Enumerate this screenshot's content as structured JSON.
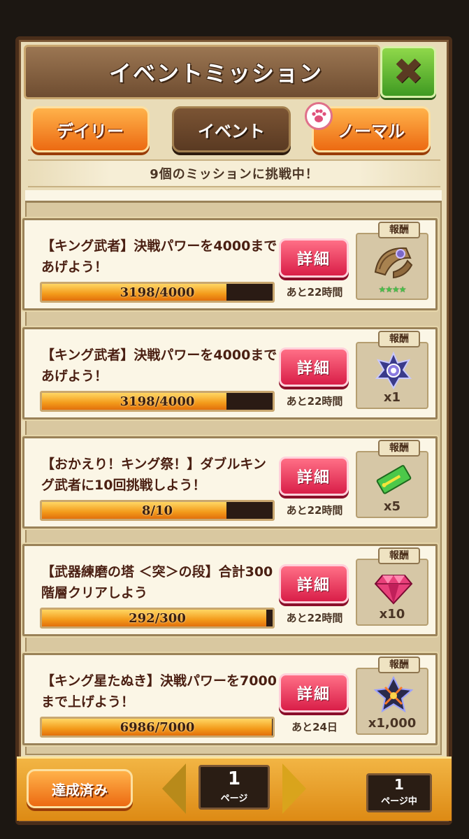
{
  "header": {
    "title": "イベントミッション",
    "close_icon": "✖"
  },
  "tabs": [
    {
      "label": "デイリー",
      "active": false
    },
    {
      "label": "イベント",
      "active": true
    },
    {
      "label": "ノーマル",
      "active": false,
      "badge_icon": "paw-icon"
    }
  ],
  "banner": "9個のミッションに挑戦中！",
  "reward_label": "報酬",
  "detail_label": "詳細",
  "missions": [
    {
      "text": "【キング武者】決戦パワーを4000まであげよう！",
      "progress_text": "3198/4000",
      "progress": 0.7995,
      "time_left": "あと22時間",
      "reward_icon": "fan-weapon-icon",
      "reward_qty": "",
      "reward_stars": "★★★★"
    },
    {
      "text": "【キング武者】決戦パワーを4000まであげよう！",
      "progress_text": "3198/4000",
      "progress": 0.7995,
      "time_left": "あと22時間",
      "reward_icon": "star-medal-icon",
      "reward_qty": "x1",
      "reward_stars": ""
    },
    {
      "text": "【おかえり！キング祭！】ダブルキング武者に10回挑戦しよう！",
      "progress_text": "8/10",
      "progress": 0.8,
      "time_left": "あと22時間",
      "reward_icon": "ticket-icon",
      "reward_qty": "x5",
      "reward_stars": ""
    },
    {
      "text": "【武器練磨の塔 ＜突＞の段】合計300階層クリアしよう",
      "progress_text": "292/300",
      "progress": 0.9733,
      "time_left": "あと22時間",
      "reward_icon": "gem-icon",
      "reward_qty": "x10",
      "reward_stars": ""
    },
    {
      "text": "【キング星たぬき】決戦パワーを7000まで上げよう！",
      "progress_text": "6986/7000",
      "progress": 0.998,
      "time_left": "あと24日",
      "reward_icon": "star-emblem-icon",
      "reward_qty": "x1,000",
      "reward_stars": ""
    }
  ],
  "footer": {
    "achieved_label": "達成済み",
    "page_num": "1",
    "page_label": "ページ",
    "current_page_num": "1",
    "current_page_label": "ページ中"
  }
}
